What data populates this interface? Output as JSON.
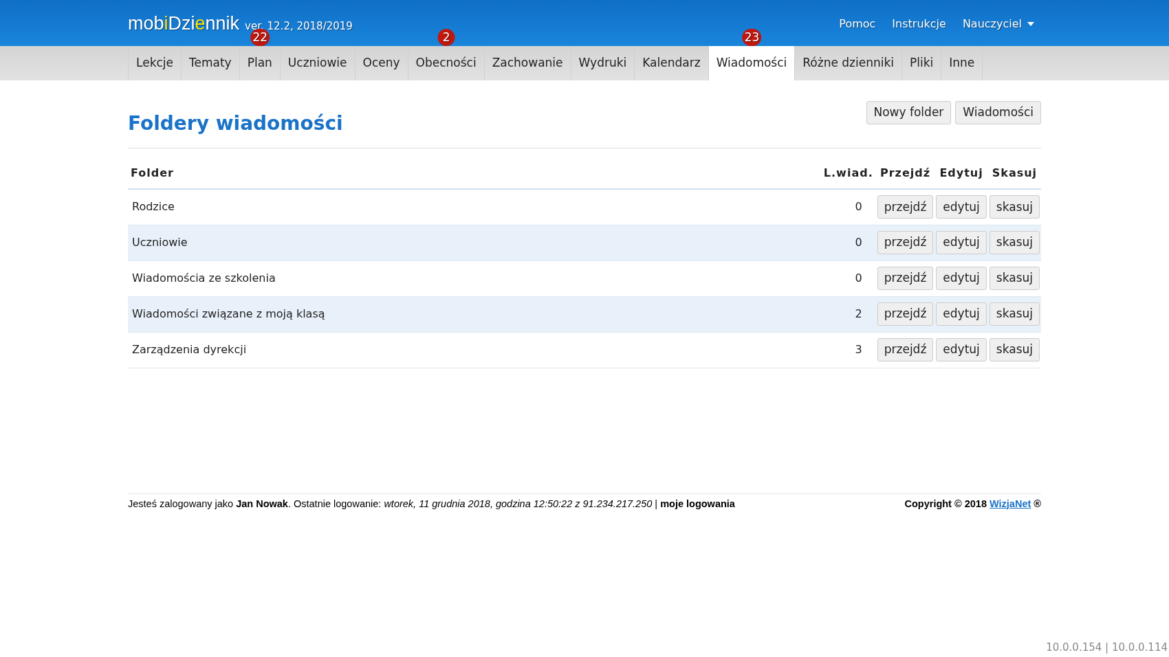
{
  "header": {
    "logo": [
      {
        "text": "mob",
        "highlight": false
      },
      {
        "text": "i",
        "highlight": true
      },
      {
        "text": "Dzi",
        "highlight": false
      },
      {
        "text": "e",
        "highlight": true
      },
      {
        "text": "nnik",
        "highlight": false
      }
    ],
    "version": "ver. 12.2, 2018/2019",
    "links": [
      "Pomoc",
      "Instrukcje"
    ],
    "user_menu": "Nauczyciel"
  },
  "tabs": [
    {
      "label": "Lekcje",
      "selected": false
    },
    {
      "label": "Tematy",
      "selected": false
    },
    {
      "label": "Plan",
      "selected": false,
      "badge": "22"
    },
    {
      "label": "Uczniowie",
      "selected": false
    },
    {
      "label": "Oceny",
      "selected": false
    },
    {
      "label": "Obecności",
      "selected": false,
      "badge": "2"
    },
    {
      "label": "Zachowanie",
      "selected": false
    },
    {
      "label": "Wydruki",
      "selected": false
    },
    {
      "label": "Kalendarz",
      "selected": false
    },
    {
      "label": "Wiadomości",
      "selected": true,
      "badge": "23"
    },
    {
      "label": "Różne dzienniki",
      "selected": false
    },
    {
      "label": "Pliki",
      "selected": false
    },
    {
      "label": "Inne",
      "selected": false
    }
  ],
  "page_title": "Foldery wiadomości",
  "toolbar_buttons": [
    "Nowy folder",
    "Wiadomości"
  ],
  "table": {
    "columns": [
      "Folder",
      "L.wiad.",
      "Przejdź",
      "Edytuj",
      "Skasuj"
    ],
    "rows": [
      {
        "folder": "Rodzice",
        "count": "0",
        "actions": [
          "przejdź",
          "edytuj",
          "skasuj"
        ]
      },
      {
        "folder": "Uczniowie",
        "count": "0",
        "actions": [
          "przejdź",
          "edytuj",
          "skasuj"
        ]
      },
      {
        "folder": "Wiadomościa ze szkolenia",
        "count": "0",
        "actions": [
          "przejdź",
          "edytuj",
          "skasuj"
        ]
      },
      {
        "folder": "Wiadomości związane z moją klasą",
        "count": "2",
        "actions": [
          "przejdź",
          "edytuj",
          "skasuj"
        ]
      },
      {
        "folder": "Zarządzenia dyrekcji",
        "count": "3",
        "actions": [
          "przejdź",
          "edytuj",
          "skasuj"
        ]
      }
    ]
  },
  "footer": {
    "login_info": "Jesteś zalogowany jako **Jan Nowak**. Ostatnie logowanie: *wtorek, 11 grudnia 2018, godzina 12:50:22 z 91.234.217.250* | **moje logowania**",
    "copyright_before": "Copyright © 2018",
    "copyright_link": "WizjaNet",
    "copyright_after": "®"
  },
  "server_info": "10.0.0.154 | 10.0.0.114"
}
